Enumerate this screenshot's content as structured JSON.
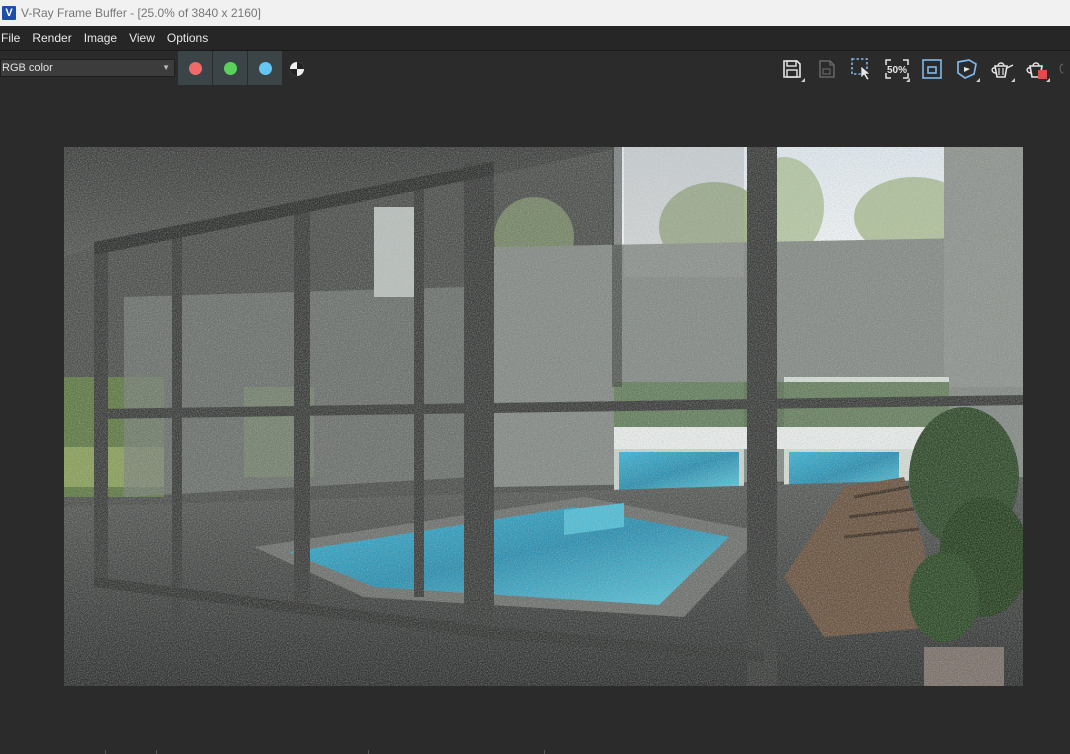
{
  "window": {
    "title": "V-Ray Frame Buffer - [25.0% of 3840 x 2160]"
  },
  "menu": {
    "items": [
      {
        "label": "File"
      },
      {
        "label": "Render"
      },
      {
        "label": "Image"
      },
      {
        "label": "View"
      },
      {
        "label": "Options"
      }
    ]
  },
  "toolbar": {
    "channel": {
      "selected": "RGB color"
    },
    "channel_buttons": [
      {
        "name": "red-channel",
        "color": "#f06a6a"
      },
      {
        "name": "green-channel",
        "color": "#5ad15a"
      },
      {
        "name": "blue-channel",
        "color": "#63c6f3"
      }
    ],
    "zoom_label": "50%",
    "icons": [
      "save-icon",
      "save-all-icon",
      "track-mouse-icon",
      "zoom-50-icon",
      "region-render-icon",
      "render-last-icon",
      "stop-render-icon",
      "clear-image-icon"
    ]
  },
  "colors": {
    "background": "#2b2b2b",
    "menubar": "#262626",
    "titlebar": "#f1f1f1",
    "accent_blue": "#1e4ea8",
    "icon_light": "#e6e6e6",
    "icon_blue": "#7fb8e8",
    "icon_red": "#e24b4b"
  }
}
